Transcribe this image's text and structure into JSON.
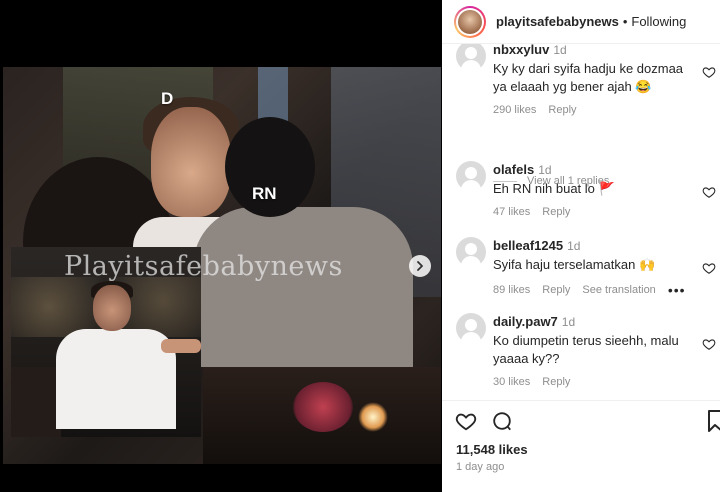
{
  "post": {
    "username": "playitsafebabynews",
    "separator": "•",
    "follow_status": "Following",
    "likes": "11,548 likes",
    "posted": "1 day ago"
  },
  "media": {
    "tag_d": "D",
    "tag_rn": "RN",
    "watermark": "Playitsafebabynews"
  },
  "comments": [
    {
      "user": "nbxxyluv",
      "time": "1d",
      "text": "Ky ky dari syifa hadju ke dozmaa ya elaaah yg bener ajah 😂",
      "likes": "290 likes",
      "reply": "Reply"
    },
    {
      "user": "olafels",
      "time": "1d",
      "text": "Eh RN nih buat lo 🚩",
      "likes": "47 likes",
      "reply": "Reply"
    },
    {
      "user": "belleaf1245",
      "time": "1d",
      "text": "Syifa haju terselamatkan 🙌",
      "likes": "89 likes",
      "reply": "Reply",
      "translate": "See translation",
      "more": "•••"
    },
    {
      "user": "daily.paw7",
      "time": "1d",
      "text": "Ko diumpetin terus sieehh, malu yaaaa ky??",
      "likes": "30 likes",
      "reply": "Reply"
    }
  ],
  "view_replies": "View all 1 replies"
}
